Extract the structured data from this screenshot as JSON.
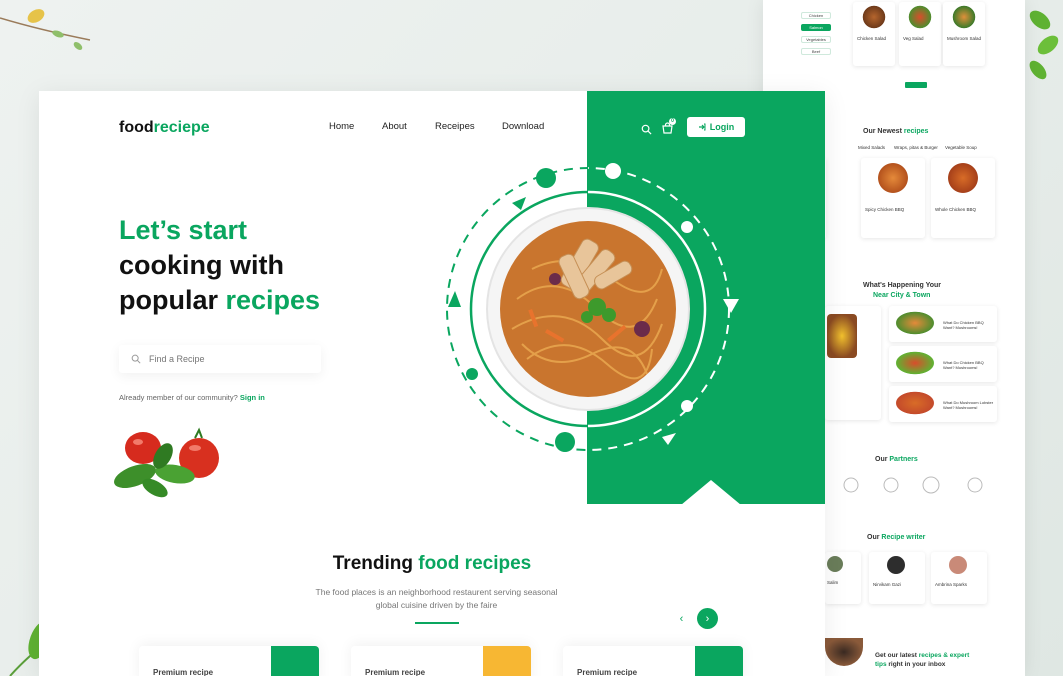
{
  "brand": {
    "name_dark": "food",
    "name_green": "reciepe"
  },
  "nav": {
    "items": [
      "Home",
      "About",
      "Receipes",
      "Download"
    ],
    "login_label": "Login",
    "cart_count": "0"
  },
  "hero": {
    "line1": "Let’s start",
    "line2": "cooking with",
    "line3_dark": "popular ",
    "line3_green": "recipes",
    "search_placeholder": "Find a Recipe",
    "member_text": "Already member of our community?",
    "signin_label": "Sign in"
  },
  "trending": {
    "title_dark": "Trending ",
    "title_green": "food recipes",
    "subtitle": "The food places is an neighborhood restaurent serving seasonal global cuisine driven by the faire",
    "prev_icon": "‹",
    "next_icon": "›",
    "cards": [
      {
        "label": "Premium recipe",
        "color": "#0aa65f"
      },
      {
        "label": "Premium recipe",
        "color": "#f7b733"
      },
      {
        "label": "Premium recipe",
        "color": "#0aa65f"
      }
    ]
  },
  "background_page": {
    "filters": [
      "Chicken",
      "Salmon",
      "Vegetables",
      "Beef"
    ],
    "top_cards": [
      "Chicken Salad",
      "Veg Salad",
      "Mushroom Salad"
    ],
    "newest_title_dark": "Our Newest ",
    "newest_title_green": "recipes",
    "newest_tabs": [
      "Mixed Salads",
      "Wraps, pitas & Burger",
      "Vegetable Soup"
    ],
    "newest_cards": [
      "Spicy Chicken BBQ",
      "Whole Chicken BBQ"
    ],
    "happening_title": "What's Happening Your",
    "happening_title2": "Near City & Town",
    "happening_items": [
      "What Do Chicken BBQ Want? Mushrooms!",
      "What Do Chicken BBQ Want? Mushrooms!",
      "What Do Mushroom Lobster Want? Mushrooms!"
    ],
    "partners_dark": "Our ",
    "partners_green": "Partners",
    "writer_dark": "Our ",
    "writer_green": "Recipe writer",
    "writers": [
      "Salim",
      "Nirvikam Gazi",
      "Ambrina Sparks"
    ],
    "newsletter_dark": "Get our latest ",
    "newsletter_green": "recipes & expert",
    "newsletter_green2": "tips",
    "newsletter_dark2": " right in your inbox"
  },
  "colors": {
    "accent": "#0aa65f",
    "orange": "#f7b733",
    "text": "#111111"
  }
}
